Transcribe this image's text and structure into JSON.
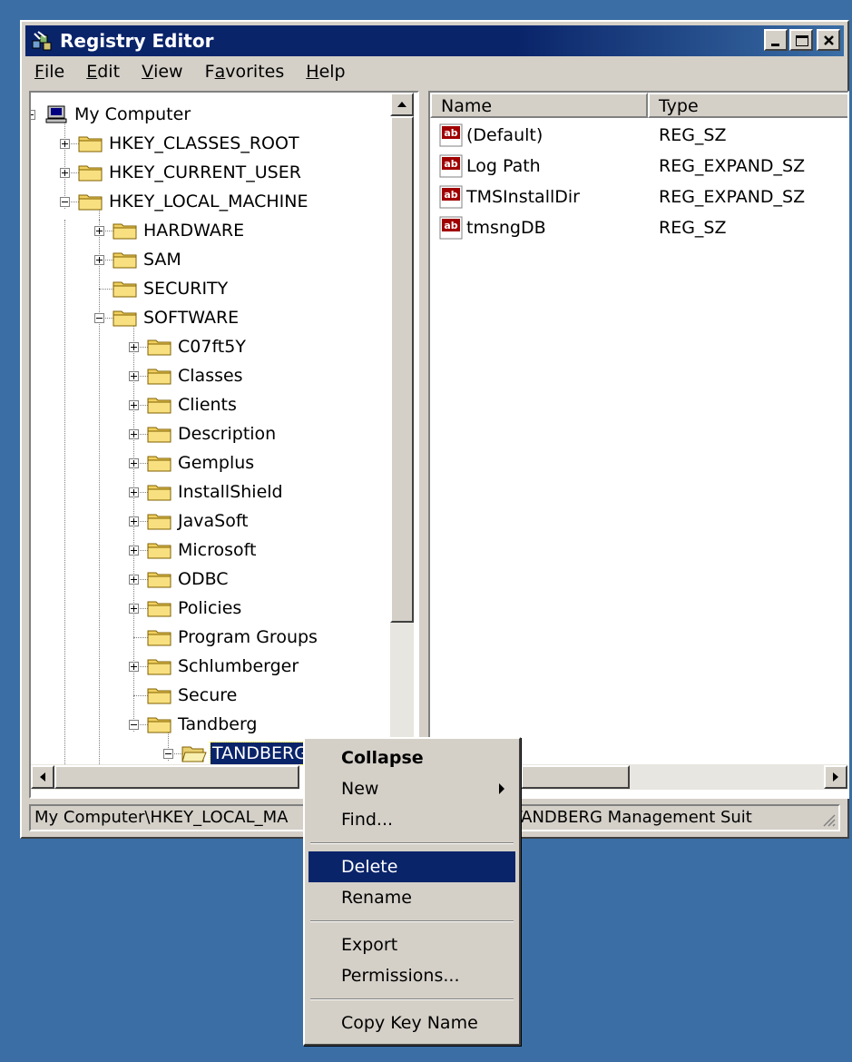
{
  "window": {
    "title": "Registry Editor",
    "controls": [
      "minimize",
      "maximize",
      "close"
    ]
  },
  "menubar": [
    {
      "label_pre": "",
      "label_u": "F",
      "label_post": "ile"
    },
    {
      "label_pre": "",
      "label_u": "E",
      "label_post": "dit"
    },
    {
      "label_pre": "",
      "label_u": "V",
      "label_post": "iew"
    },
    {
      "label_pre": "F",
      "label_u": "a",
      "label_post": "vorites"
    },
    {
      "label_pre": "",
      "label_u": "H",
      "label_post": "elp"
    }
  ],
  "tree": {
    "root": "My Computer",
    "hives": [
      "HKEY_CLASSES_ROOT",
      "HKEY_CURRENT_USER",
      "HKEY_LOCAL_MACHINE"
    ],
    "hklm_children": [
      "HARDWARE",
      "SAM",
      "SECURITY",
      "SOFTWARE"
    ],
    "software_children": [
      "C07ft5Y",
      "Classes",
      "Clients",
      "Description",
      "Gemplus",
      "InstallShield",
      "JavaSoft",
      "Microsoft",
      "ODBC",
      "Policies",
      "Program Groups",
      "Schlumberger",
      "Secure",
      "Tandberg"
    ],
    "selected_key": "TANDBERG Management Suit"
  },
  "list": {
    "columns": [
      "Name",
      "Type"
    ],
    "values": [
      {
        "name": "(Default)",
        "type": "REG_SZ"
      },
      {
        "name": "Log Path",
        "type": "REG_EXPAND_SZ"
      },
      {
        "name": "TMSInstallDir",
        "type": "REG_EXPAND_SZ"
      },
      {
        "name": "tmsngDB",
        "type": "REG_SZ"
      }
    ],
    "value_icon": "string-value-icon"
  },
  "statusbar": {
    "left": "My Computer\\HKEY_LOCAL_MA",
    "right": "berg\\TANDBERG Management Suit"
  },
  "context_menu": {
    "collapse": "Collapse",
    "new": "New",
    "find": "Find...",
    "delete": "Delete",
    "rename": "Rename",
    "export": "Export",
    "permissions": "Permissions...",
    "copy_key_name": "Copy Key Name",
    "highlighted": "Delete"
  },
  "colors": {
    "desktop": "#3a6ea5",
    "title_active": "#0a246a",
    "face": "#d4d0c8",
    "highlight": "#0a246a"
  }
}
